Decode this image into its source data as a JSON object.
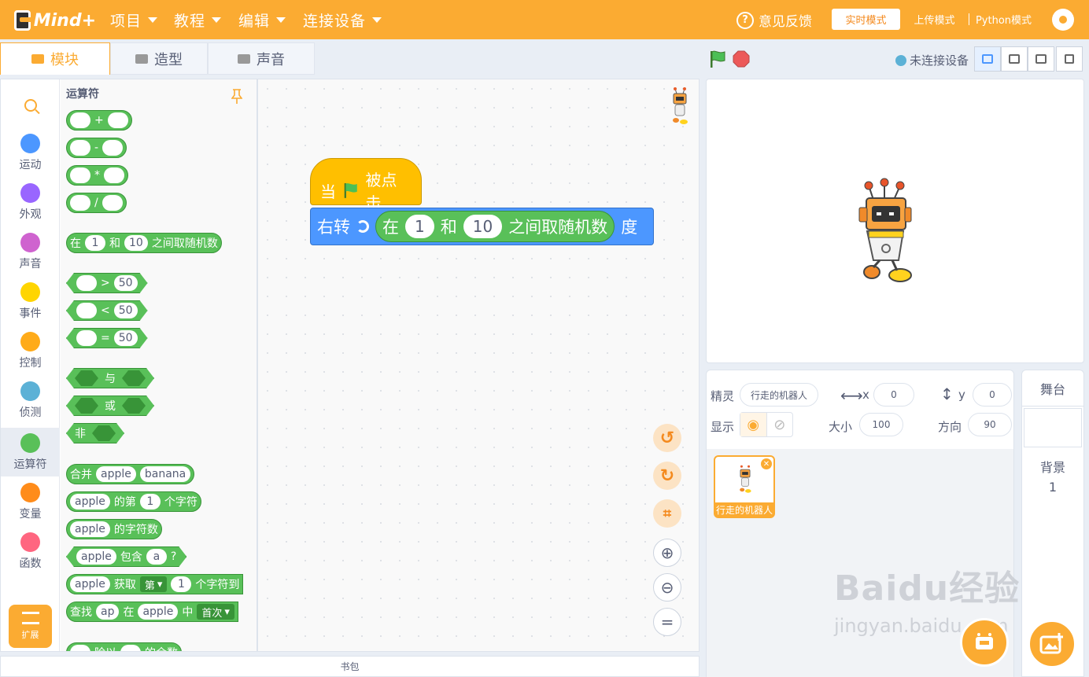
{
  "menubar": {
    "logo_text": "Mind+",
    "menus": [
      "项目",
      "教程",
      "编辑",
      "连接设备"
    ],
    "feedback": "意见反馈",
    "modes": [
      "实时模式",
      "上传模式",
      "Python模式"
    ],
    "active_mode": "实时模式"
  },
  "tabs": [
    "模块",
    "造型",
    "声音"
  ],
  "status": {
    "connection": "未连接设备"
  },
  "categories": [
    "运动",
    "外观",
    "声音",
    "事件",
    "控制",
    "侦测",
    "运算符",
    "变量",
    "函数"
  ],
  "category_colors": [
    "#4c97ff",
    "#9966ff",
    "#cf63cf",
    "#ffd500",
    "#ffab19",
    "#5cb1d6",
    "#59c059",
    "#ff8c1a",
    "#ff6680"
  ],
  "selected_category": "运算符",
  "extension_label": "扩展",
  "flyout": {
    "title": "运算符",
    "ops": [
      "+",
      "-",
      "*",
      "/"
    ],
    "random": {
      "a": "在",
      "v1": "1",
      "b": "和",
      "v2": "10",
      "c": "之间取随机数"
    },
    "compare": [
      {
        "op": ">",
        "v": "50"
      },
      {
        "op": "<",
        "v": "50"
      },
      {
        "op": "=",
        "v": "50"
      }
    ],
    "logic": [
      "与",
      "或",
      "非"
    ],
    "join": {
      "label": "合并",
      "a": "apple",
      "b": "banana"
    },
    "letter_of": {
      "a": "apple",
      "b": "的第",
      "n": "1",
      "c": "个字符"
    },
    "length_of": {
      "a": "apple",
      "b": "的字符数"
    },
    "contains": {
      "a": "apple",
      "b": "包含",
      "c": "a",
      "d": "?"
    },
    "get_sub": {
      "a": "apple",
      "b": "获取",
      "dd": "第",
      "n": "1",
      "c": "个字符到"
    },
    "find": {
      "a": "查找",
      "b": "ap",
      "c": "在",
      "d": "apple",
      "e": "中",
      "dd": "首次"
    },
    "mod": {
      "a": "除以",
      "b": "的余数"
    }
  },
  "script": {
    "hat": {
      "when": "当",
      "clicked": "被点击"
    },
    "turn": {
      "label": "右转",
      "a": "在",
      "v1": "1",
      "b": "和",
      "v2": "10",
      "c": "之间取随机数",
      "unit": "度"
    }
  },
  "bag_label": "书包",
  "sprite": {
    "label": "精灵",
    "name": "行走的机器人",
    "x_label": "x",
    "x": "0",
    "y_label": "y",
    "y": "0",
    "show_label": "显示",
    "size_label": "大小",
    "size": "100",
    "dir_label": "方向",
    "dir": "90",
    "thumb_name": "行走的机器人"
  },
  "stage_panel": {
    "title": "舞台",
    "backdrop_label": "背景",
    "backdrop_count": "1"
  },
  "watermark": {
    "brand": "Baidu经验",
    "url": "jingyan.baidu.com"
  },
  "colors": {
    "accent": "#fbab32",
    "motion": "#4c97ff",
    "operator": "#59c059",
    "event": "#ffbf00"
  }
}
